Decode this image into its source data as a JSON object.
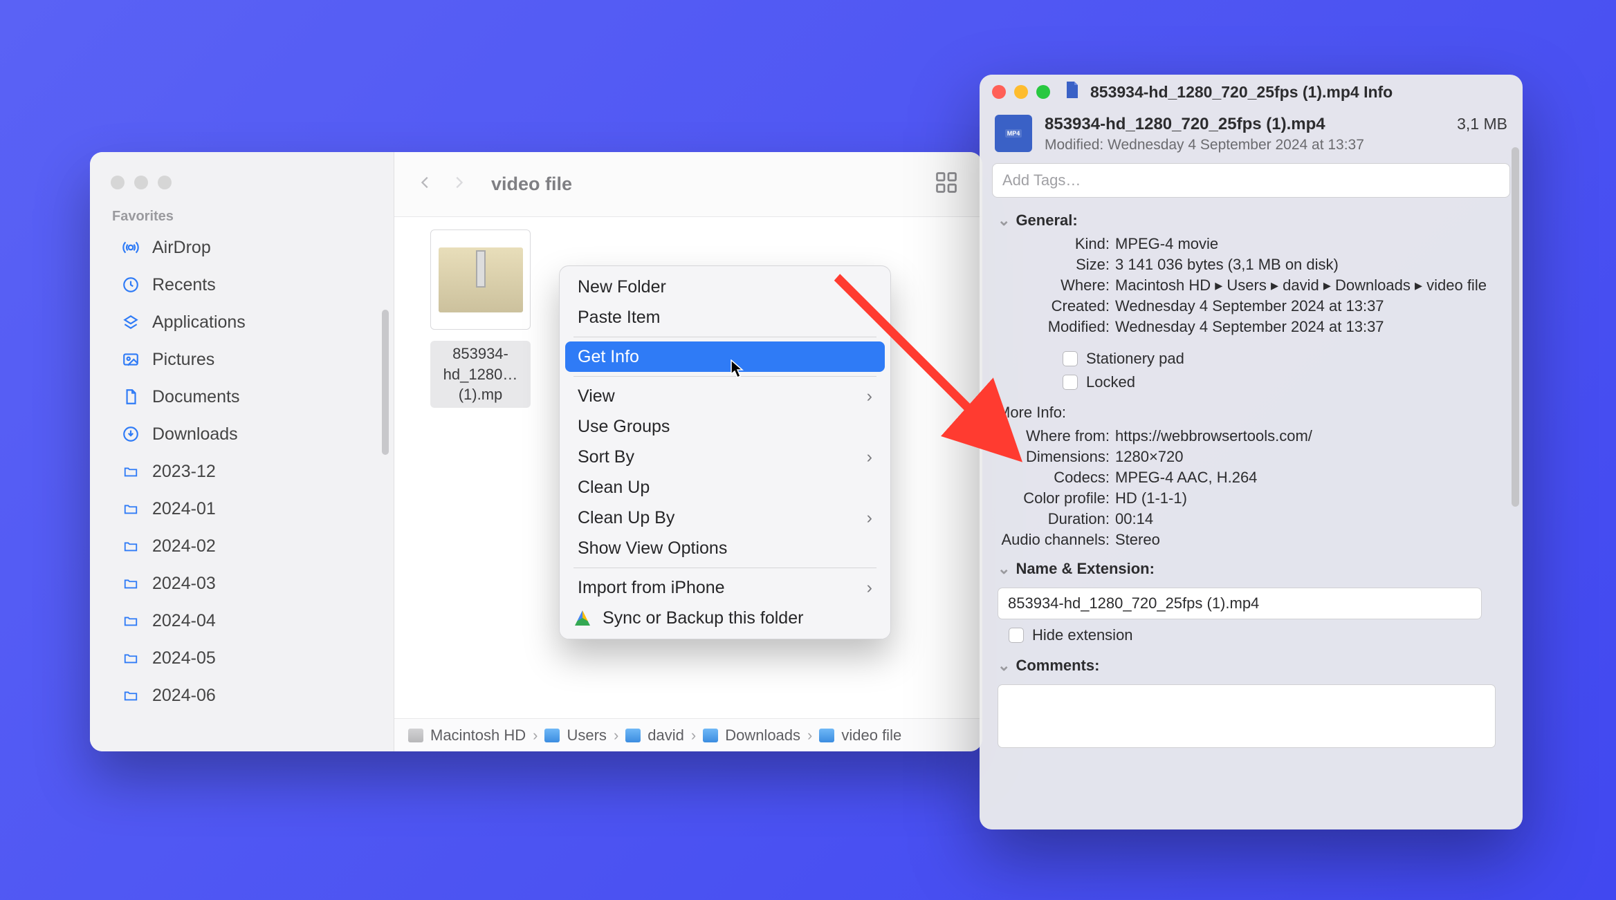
{
  "finder": {
    "title": "video file",
    "sidebar": {
      "heading": "Favorites",
      "items": [
        {
          "label": "AirDrop"
        },
        {
          "label": "Recents"
        },
        {
          "label": "Applications"
        },
        {
          "label": "Pictures"
        },
        {
          "label": "Documents"
        },
        {
          "label": "Downloads"
        },
        {
          "label": "2023-12"
        },
        {
          "label": "2024-01"
        },
        {
          "label": "2024-02"
        },
        {
          "label": "2024-03"
        },
        {
          "label": "2024-04"
        },
        {
          "label": "2024-05"
        },
        {
          "label": "2024-06"
        }
      ]
    },
    "file": {
      "name_line1": "853934-",
      "name_line2": "hd_1280…(1).mp"
    },
    "context_menu": {
      "new_folder": "New Folder",
      "paste_item": "Paste Item",
      "get_info": "Get Info",
      "view": "View",
      "use_groups": "Use Groups",
      "sort_by": "Sort By",
      "clean_up": "Clean Up",
      "clean_up_by": "Clean Up By",
      "show_view_options": "Show View Options",
      "import_from_iphone": "Import from iPhone",
      "sync_backup": "Sync or Backup this folder"
    },
    "pathbar": [
      "Macintosh HD",
      "Users",
      "david",
      "Downloads",
      "video file"
    ]
  },
  "info": {
    "window_title": "853934-hd_1280_720_25fps (1).mp4 Info",
    "filename": "853934-hd_1280_720_25fps (1).mp4",
    "size_short": "3,1 MB",
    "modified_line": "Modified:  Wednesday 4 September 2024 at 13:37",
    "tags_placeholder": "Add Tags…",
    "sections": {
      "general": "General:",
      "more_info": "More Info:",
      "name_ext": "Name & Extension:",
      "comments": "Comments:"
    },
    "general": {
      "kind_k": "Kind:",
      "kind_v": "MPEG-4 movie",
      "size_k": "Size:",
      "size_v": "3 141 036 bytes (3,1 MB on disk)",
      "where_k": "Where:",
      "where_v": "Macintosh HD ▸ Users ▸ david ▸ Downloads ▸ video file",
      "created_k": "Created:",
      "created_v": "Wednesday 4 September 2024 at 13:37",
      "modified_k": "Modified:",
      "modified_v": "Wednesday 4 September 2024 at 13:37",
      "stationery": "Stationery pad",
      "locked": "Locked"
    },
    "more": {
      "wherefrom_k": "Where from:",
      "wherefrom_v": "https://webbrowsertools.com/",
      "dim_k": "Dimensions:",
      "dim_v": "1280×720",
      "codecs_k": "Codecs:",
      "codecs_v": "MPEG-4 AAC, H.264",
      "colorprof_k": "Color profile:",
      "colorprof_v": "HD (1-1-1)",
      "dur_k": "Duration:",
      "dur_v": "00:14",
      "audio_k": "Audio channels:",
      "audio_v": "Stereo"
    },
    "name_ext_value": "853934-hd_1280_720_25fps (1).mp4",
    "hide_ext": "Hide extension"
  }
}
